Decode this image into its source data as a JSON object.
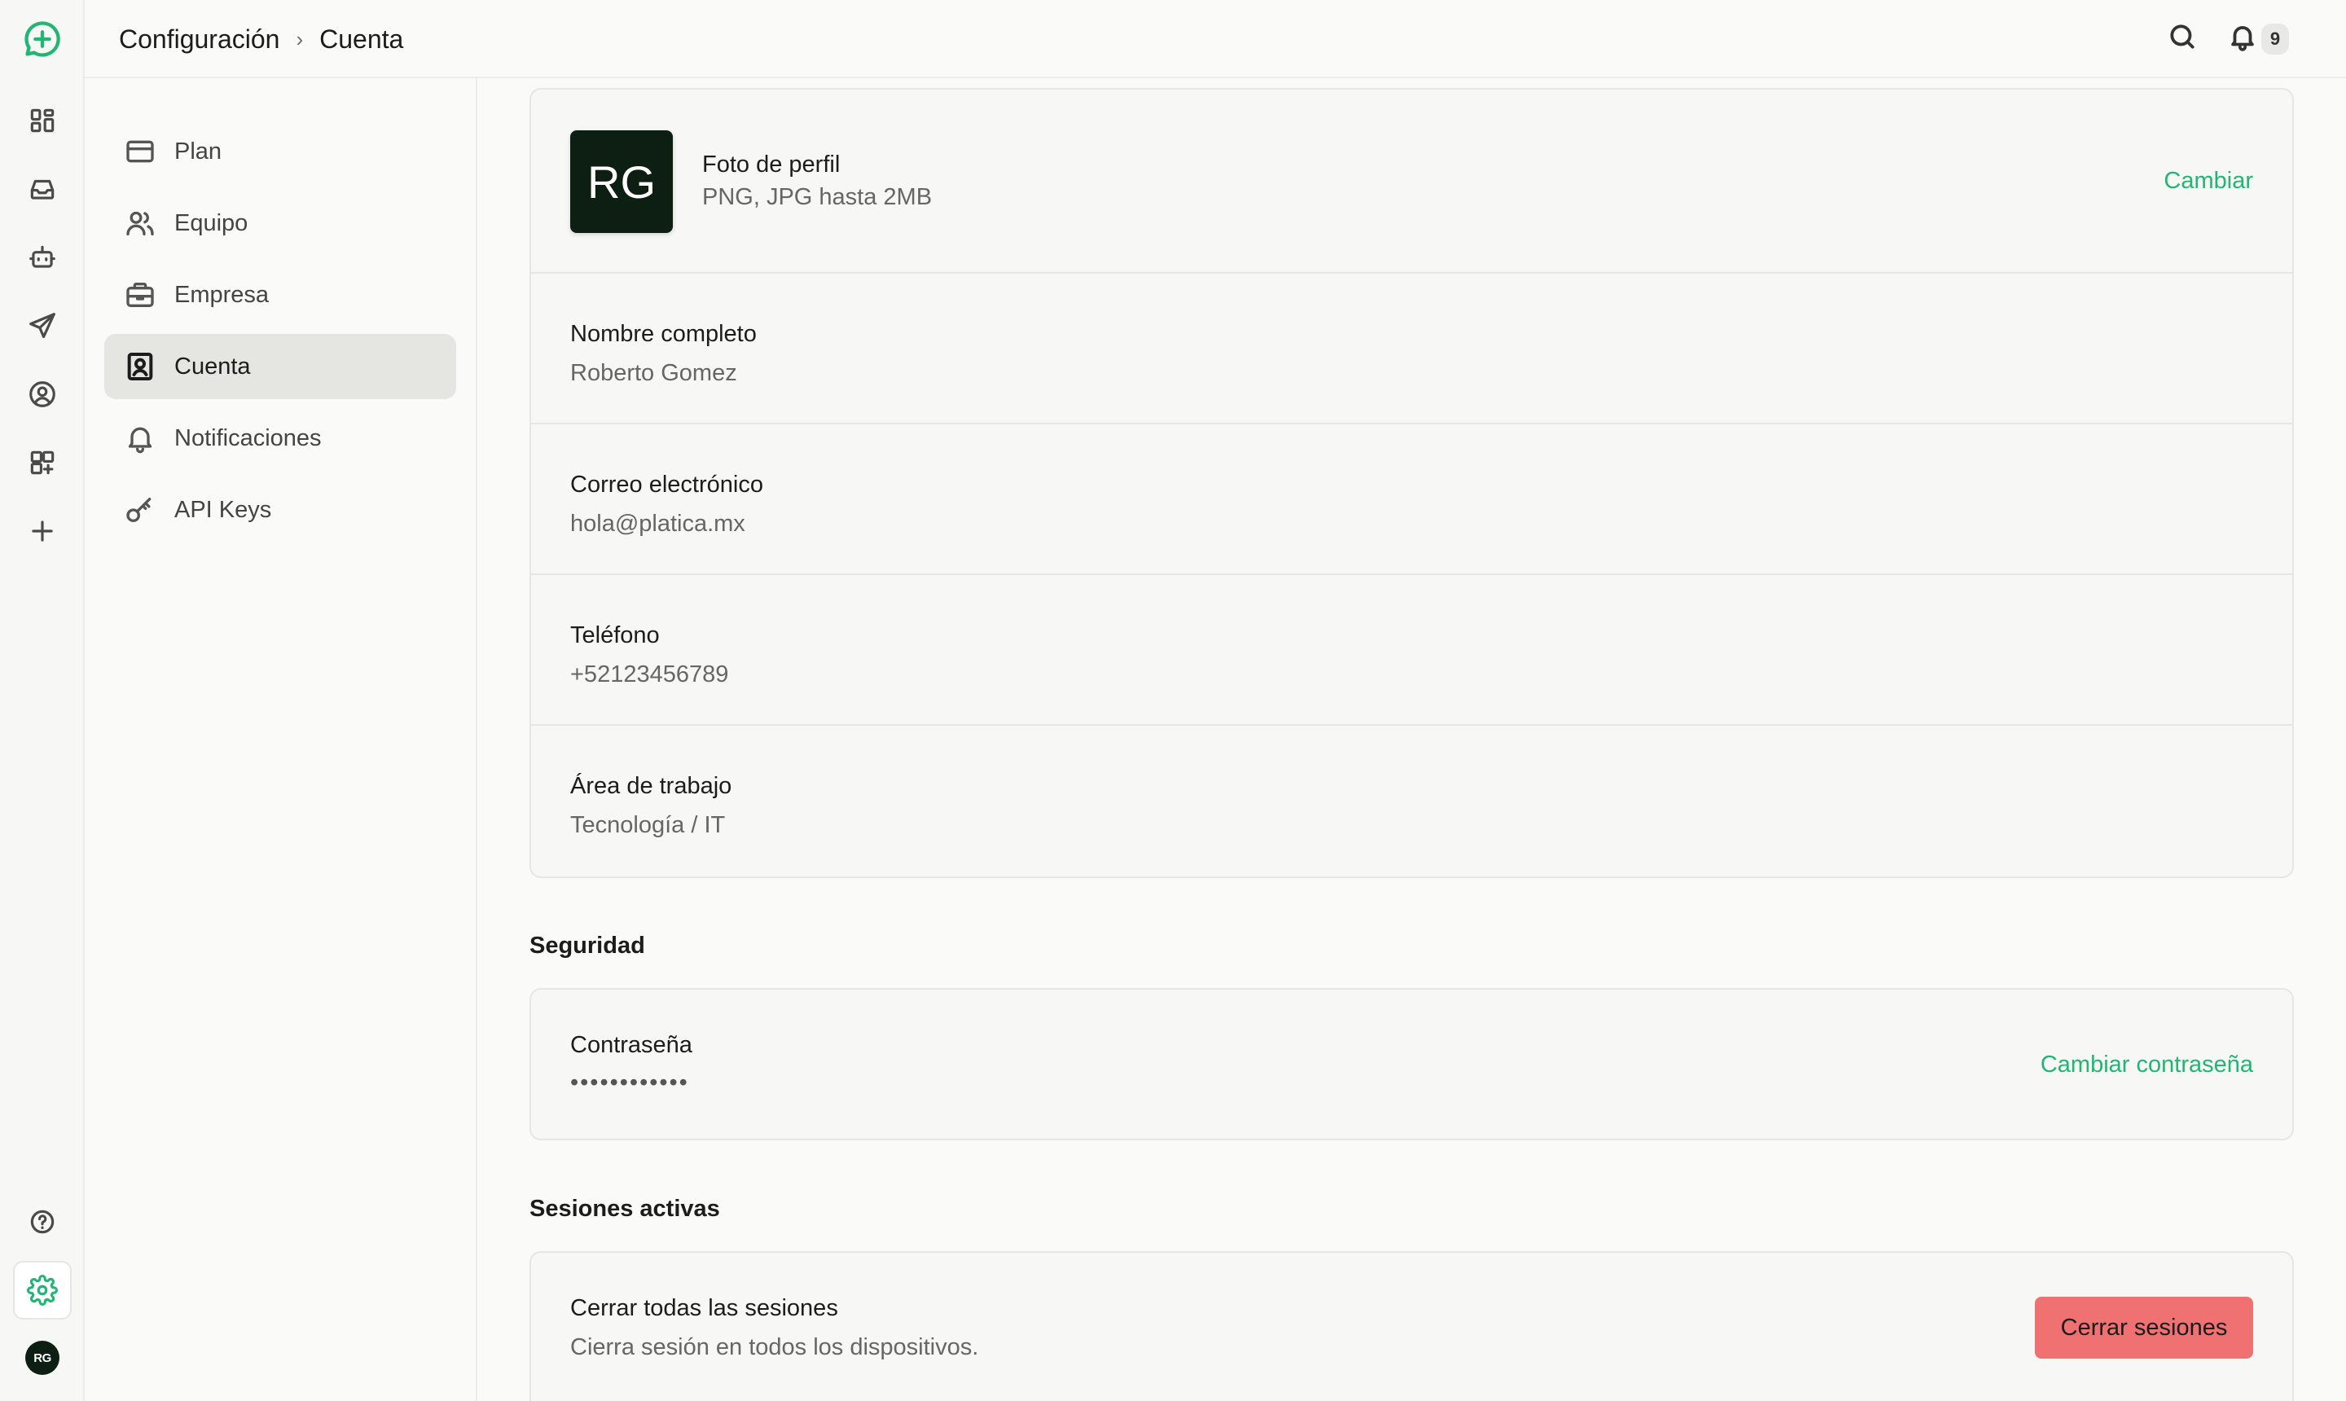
{
  "breadcrumb": {
    "root": "Configuración",
    "current": "Cuenta"
  },
  "notifications": {
    "count": "9"
  },
  "rail": {
    "avatar_initials": "RG",
    "icons": [
      "logo-chat-icon",
      "dashboard-icon",
      "inbox-icon",
      "bot-icon",
      "send-icon",
      "contact-icon",
      "apps-add-icon",
      "plus-icon",
      "help-icon",
      "settings-icon"
    ]
  },
  "subnav": {
    "items": [
      {
        "label": "Plan",
        "icon": "credit-card-icon"
      },
      {
        "label": "Equipo",
        "icon": "users-icon"
      },
      {
        "label": "Empresa",
        "icon": "briefcase-icon"
      },
      {
        "label": "Cuenta",
        "icon": "account-icon",
        "active": true
      },
      {
        "label": "Notificaciones",
        "icon": "bell-icon"
      },
      {
        "label": "API Keys",
        "icon": "key-icon"
      }
    ]
  },
  "profile": {
    "photo_initials": "RG",
    "photo_title": "Foto de perfil",
    "photo_hint": "PNG, JPG hasta 2MB",
    "change_label": "Cambiar",
    "fields": [
      {
        "label": "Nombre completo",
        "value": "Roberto Gomez"
      },
      {
        "label": "Correo electrónico",
        "value": "hola@platica.mx"
      },
      {
        "label": "Teléfono",
        "value": "+52123456789"
      },
      {
        "label": "Área de trabajo",
        "value": "Tecnología / IT"
      }
    ]
  },
  "security": {
    "title": "Seguridad",
    "password_label": "Contraseña",
    "password_value": "••••••••••••",
    "change_password_label": "Cambiar contraseña"
  },
  "sessions": {
    "title": "Sesiones activas",
    "close_all_label": "Cerrar todas las sesiones",
    "close_all_desc": "Cierra sesión en todos los dispositivos.",
    "button_label": "Cerrar sesiones"
  },
  "colors": {
    "accent": "#22b573",
    "danger": "#f07171",
    "avatar_bg": "#0c1f12"
  }
}
